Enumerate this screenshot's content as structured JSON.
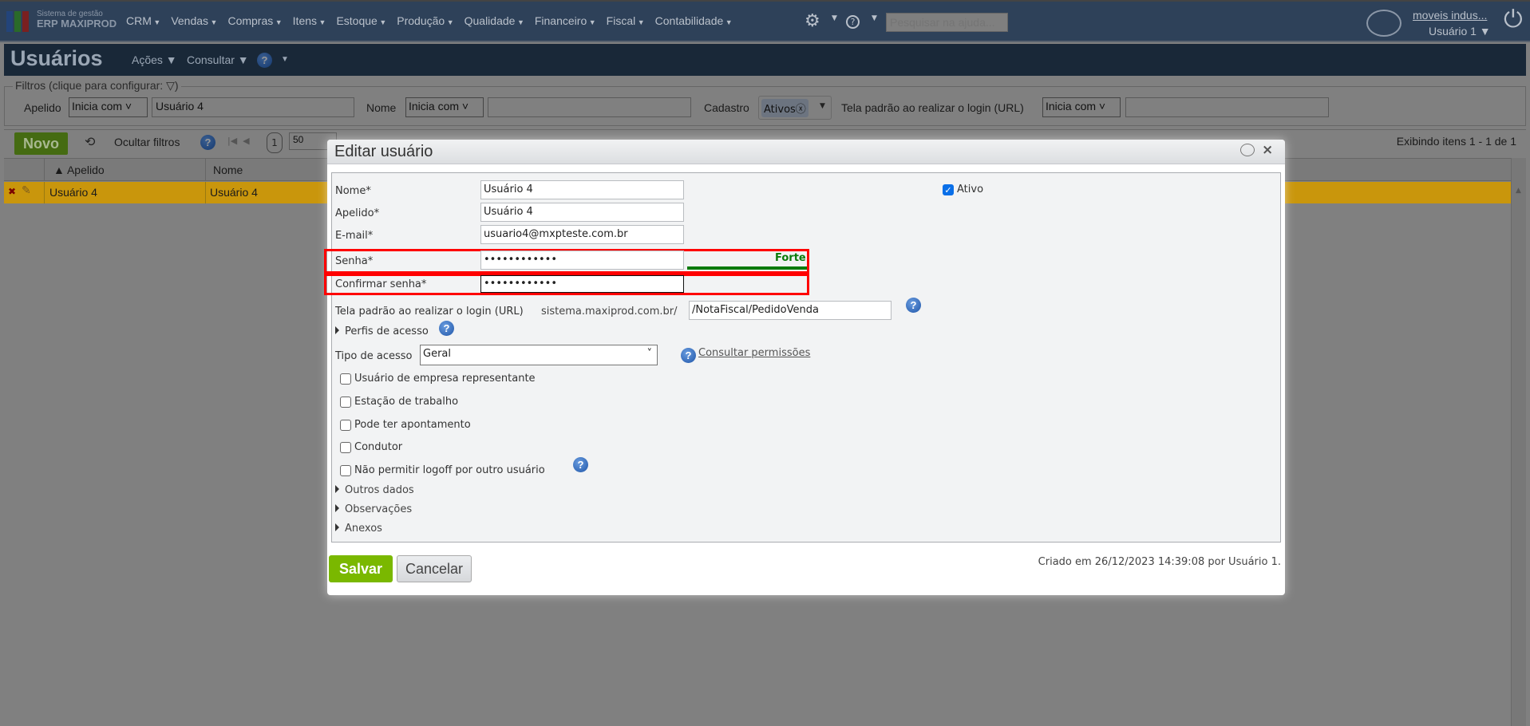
{
  "topbar": {
    "logo_line1": "Sistema de gestão",
    "logo_line2": "ERP MAXIPROD",
    "menu": [
      "CRM",
      "Vendas",
      "Compras",
      "Itens",
      "Estoque",
      "Produção",
      "Qualidade",
      "Financeiro",
      "Fiscal",
      "Contabilidade"
    ],
    "search_placeholder": "Pesquisar na ajuda...",
    "company": "moveis indus...",
    "user": "Usuário 1 ▼"
  },
  "header": {
    "title": "Usuários",
    "actions": "Ações ▼",
    "consult": "Consultar ▼",
    "more": "▼"
  },
  "filters": {
    "legend": "Filtros (clique para configurar:",
    "legend_end": ")",
    "apelido_label": "Apelido",
    "apelido_op": "Inicia com",
    "apelido_value": "Usuário 4",
    "nome_label": "Nome",
    "nome_op": "Inicia com",
    "nome_value": "",
    "cadastro_label": "Cadastro",
    "cadastro_chip": "Ativos",
    "tela_label": "Tela padrão ao realizar o login (URL)",
    "tela_op": "Inicia com",
    "tela_value": ""
  },
  "toolbar": {
    "new": "Novo",
    "hide_filters": "Ocultar filtros",
    "page": "1",
    "page_size": "50",
    "showing": "Exibindo itens 1 - 1 de 1"
  },
  "grid": {
    "columns": [
      "▲ Apelido",
      "Nome"
    ],
    "rows": [
      [
        "Usuário 4",
        "Usuário 4"
      ]
    ]
  },
  "dialog": {
    "title": "Editar usuário",
    "nome_label": "Nome*",
    "nome": "Usuário 4",
    "apelido_label": "Apelido*",
    "apelido": "Usuário 4",
    "email_label": "E-mail*",
    "email": "usuario4@mxpteste.com.br",
    "senha_label": "Senha*",
    "senha": "••••••••••••",
    "strength": "Forte",
    "strength_color": "#0a7a0a",
    "confirm_label": "Confirmar senha*",
    "confirm": "••••••••••••",
    "ativo_label": "Ativo",
    "ativo": true,
    "tela_label": "Tela padrão ao realizar o login (URL)",
    "tela_prefix": "sistema.maxiprod.com.br/",
    "tela_value": "/NotaFiscal/PedidoVenda",
    "perfis": "Perfis de acesso",
    "tipo_label": "Tipo de acesso",
    "tipo_value": "Geral",
    "consult_link": "Consultar permissões",
    "checkboxes": [
      "Usuário de empresa representante",
      "Estação de trabalho",
      "Pode ter apontamento",
      "Condutor",
      "Não permitir logoff por outro usuário"
    ],
    "sections": [
      "Outros dados",
      "Observações",
      "Anexos"
    ],
    "save": "Salvar",
    "cancel": "Cancelar",
    "created": "Criado em 26/12/2023 14:39:08 por Usuário 1."
  }
}
